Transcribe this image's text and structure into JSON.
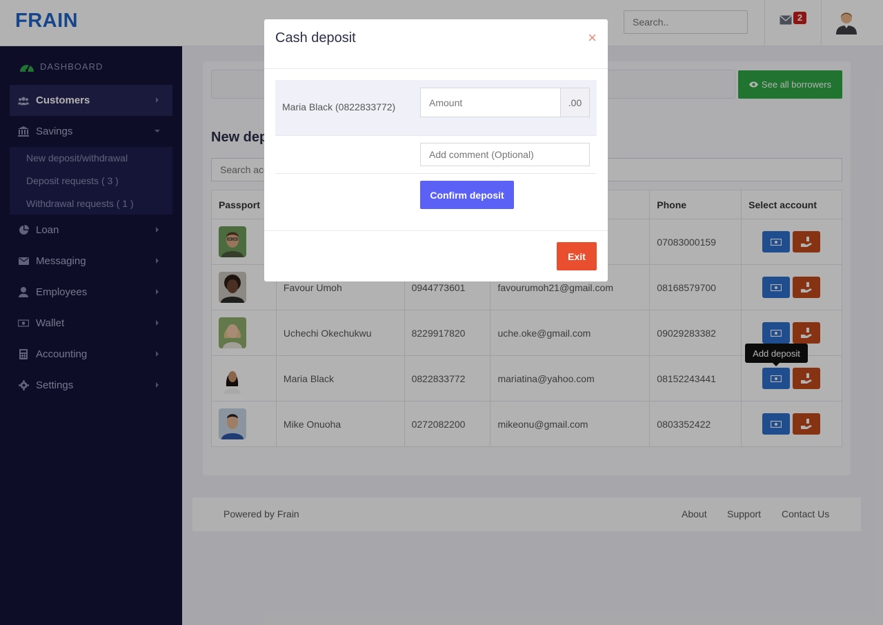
{
  "brand": {
    "logo": "FRAIN"
  },
  "header": {
    "search_placeholder": "Search..",
    "mail_count": "2"
  },
  "sidebar": {
    "dashboard_label": "DASHBOARD",
    "items": [
      {
        "label": "Customers",
        "icon": "users-icon",
        "active": true
      },
      {
        "label": "Savings",
        "icon": "bank-icon",
        "expanded": true
      },
      {
        "label": "Loan",
        "icon": "pie-chart-icon"
      },
      {
        "label": "Messaging",
        "icon": "envelope-icon"
      },
      {
        "label": "Employees",
        "icon": "user-icon"
      },
      {
        "label": "Wallet",
        "icon": "money-icon"
      },
      {
        "label": "Accounting",
        "icon": "calculator-icon"
      },
      {
        "label": "Settings",
        "icon": "gear-icon"
      }
    ],
    "submenu": [
      {
        "label": "New deposit/withdrawal"
      },
      {
        "label": "Deposit requests ( 3 )"
      },
      {
        "label": "Withdrawal requests ( 1 )"
      }
    ]
  },
  "main": {
    "see_all_label": "See all borrowers",
    "section_title": "New dep",
    "account_search_placeholder": "Search acc",
    "table": {
      "headers": [
        "Passport",
        "",
        "",
        "",
        "Phone",
        "Select account"
      ],
      "rows": [
        {
          "name": "",
          "account": "",
          "email": "",
          "phone": "07083000159"
        },
        {
          "name": "Favour Umoh",
          "account": "0944773601",
          "email": "favourumoh21@gmail.com",
          "phone": "08168579700"
        },
        {
          "name": "Uchechi Okechukwu",
          "account": "8229917820",
          "email": "uche.oke@gmail.com",
          "phone": "09029283382"
        },
        {
          "name": "Maria Black",
          "account": "0822833772",
          "email": "mariatina@yahoo.com",
          "phone": "08152243441"
        },
        {
          "name": "Mike Onuoha",
          "account": "0272082200",
          "email": "mikeonu@gmail.com",
          "phone": "0803352422"
        }
      ]
    },
    "tooltip": "Add deposit"
  },
  "footer": {
    "powered_by": "Powered by Frain",
    "links": [
      "About",
      "Support",
      "Contact Us"
    ]
  },
  "modal": {
    "title": "Cash deposit",
    "close_symbol": "×",
    "account_label": "Maria Black (0822833772)",
    "amount_placeholder": "Amount",
    "amount_suffix": ".00",
    "comment_placeholder": "Add comment (Optional)",
    "confirm_label": "Confirm deposit",
    "exit_label": "Exit"
  },
  "colors": {
    "sidebar_bg": "#13133a",
    "brand_blue": "#1f63c7",
    "confirm": "#5b61f5",
    "exit": "#e94f2e",
    "deposit_button": "#2d6fcb",
    "withdraw_button": "#c04a1d",
    "see_all": "#2ea745"
  }
}
